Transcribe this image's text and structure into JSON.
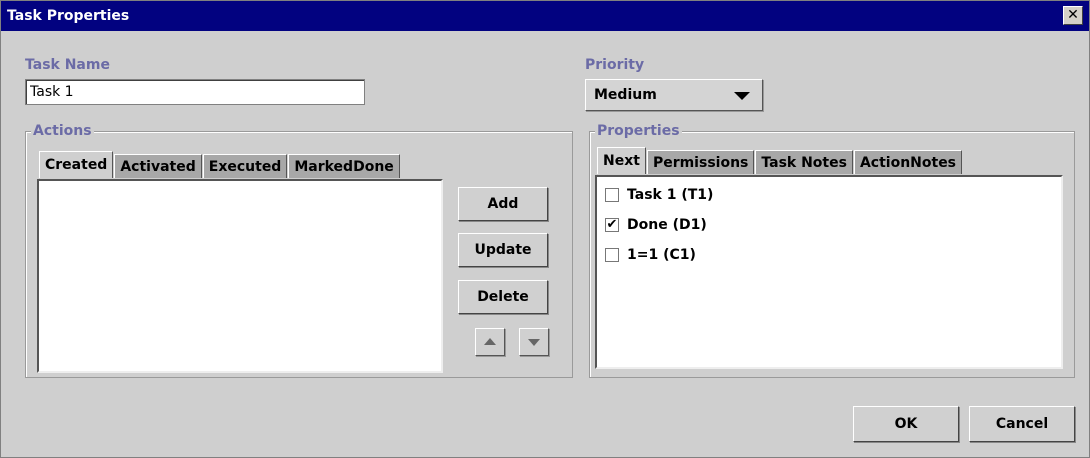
{
  "window": {
    "title": "Task Properties",
    "close_glyph": "✕"
  },
  "task_name": {
    "label": "Task Name",
    "value": "Task 1"
  },
  "priority": {
    "label": "Priority",
    "selected": "Medium"
  },
  "actions": {
    "title": "Actions",
    "tabs": [
      "Created",
      "Activated",
      "Executed",
      "MarkedDone"
    ],
    "active_tab": "Created",
    "buttons": {
      "add": "Add",
      "update": "Update",
      "delete": "Delete"
    }
  },
  "properties": {
    "title": "Properties",
    "tabs": [
      "Next",
      "Permissions",
      "Task Notes",
      "ActionNotes"
    ],
    "active_tab": "Next",
    "items": [
      {
        "label": "Task 1 (T1)",
        "checked": false
      },
      {
        "label": "Done (D1)",
        "checked": true
      },
      {
        "label": "1=1 (C1)",
        "checked": false
      }
    ]
  },
  "footer": {
    "ok": "OK",
    "cancel": "Cancel"
  },
  "colors": {
    "titlebar": "#020280",
    "label_accent": "#6b6ba6",
    "background": "#cfcfcf"
  }
}
